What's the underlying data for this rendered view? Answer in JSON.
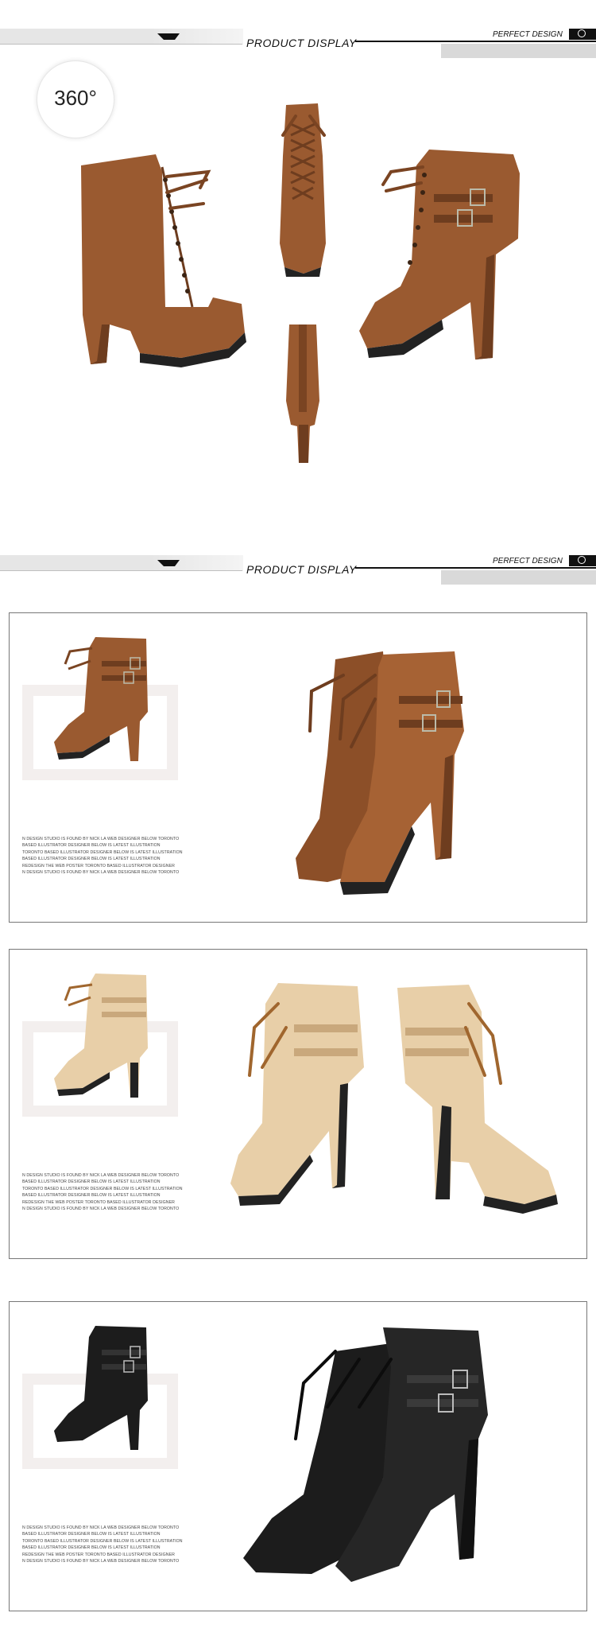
{
  "sections": [
    {
      "title": "PRODUCT DISPLAY",
      "subtitle": "PERFECT DESIGN"
    },
    {
      "title": "PRODUCT DISPLAY",
      "subtitle": "PERFECT DESIGN"
    }
  ],
  "badge": {
    "text": "360°"
  },
  "colors": {
    "brown": "#9a5a30",
    "brown_dark": "#6e3d1f",
    "beige": "#e8cfa8",
    "beige_dark": "#c9a87c",
    "black": "#1c1c1c",
    "frame": "#f3efee"
  },
  "description_lines": [
    "N DESIGN STUDIO IS FOUND BY NICK LA  WEB DESIGNER BELOW TORONTO",
    "BASED ILLUSTRATOR DESIGNER BELOW IS LATEST ILLUSTRATION",
    "TORONTO BASED ILLUSTRATOR DESIGNER BELOW IS LATEST ILLUSTRATION",
    "BASED ILLUSTRATOR DESIGNER BELOW IS LATEST ILLUSTRATION",
    "REDESIGN THE WEB POSTER TORONTO BASED ILLUSTRATOR DESIGNER",
    "N DESIGN STUDIO IS FOUND BY NICK LA  WEB DESIGNER BELOW TORONTO"
  ],
  "panels": [
    {
      "color_name": "brown"
    },
    {
      "color_name": "beige"
    },
    {
      "color_name": "black"
    }
  ]
}
